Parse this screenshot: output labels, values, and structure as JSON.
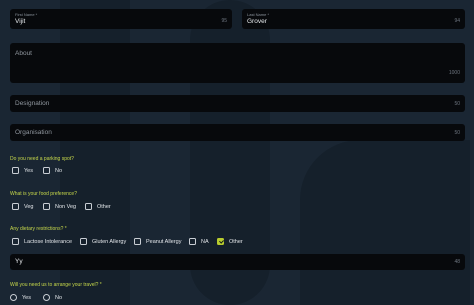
{
  "form": {
    "first_name": {
      "label": "First Name *",
      "value": "Vijit",
      "count": "95"
    },
    "last_name": {
      "label": "Last Name *",
      "value": "Grover",
      "count": "94"
    },
    "about": {
      "placeholder": "About",
      "count": "1000"
    },
    "designation": {
      "placeholder": "Designation",
      "count": "50"
    },
    "organisation": {
      "placeholder": "Organisation",
      "count": "50"
    },
    "parking": {
      "question": "Do you need a parking spot?",
      "options": [
        "Yes",
        "No"
      ]
    },
    "food": {
      "question": "What is your food preference?",
      "options": [
        "Veg",
        "Non Veg",
        "Other"
      ]
    },
    "dietary": {
      "question": "Any dietary restrictions? *",
      "options": [
        "Lactose Intolerance",
        "Gluten Allergy",
        "Peanut Allergy",
        "NA",
        "Other"
      ],
      "checked": "Other"
    },
    "dietary_other": {
      "value": "Yy",
      "count": "48"
    },
    "travel": {
      "question": "Will you need us to arrange your travel? *",
      "options": [
        "Yes",
        "No"
      ]
    }
  },
  "colors": {
    "accent": "#c7d84a",
    "field_bg": "#07090c",
    "page_bg": "#1a2633"
  }
}
